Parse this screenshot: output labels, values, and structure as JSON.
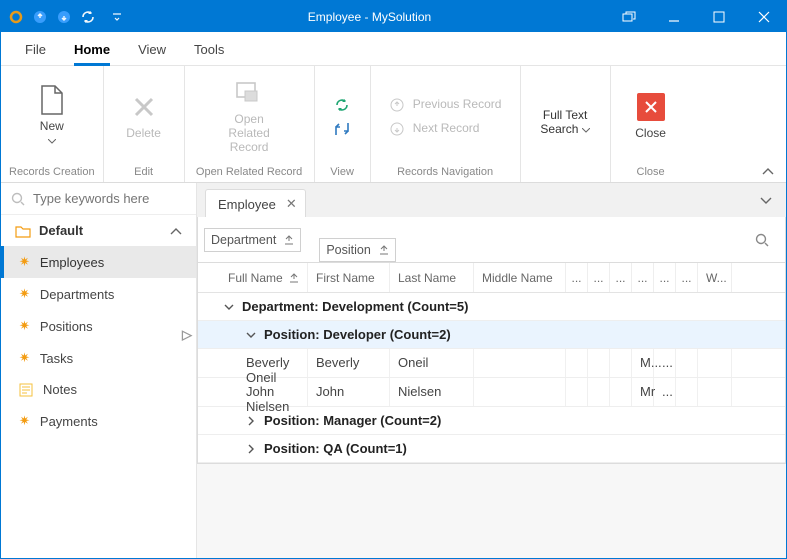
{
  "colors": {
    "accent": "#0078d4",
    "close_btn": "#e74c3c",
    "gear": "#f39c12"
  },
  "title": "Employee - MySolution",
  "menu": {
    "file": "File",
    "home": "Home",
    "view": "View",
    "tools": "Tools"
  },
  "ribbon": {
    "records_creation": {
      "new": "New",
      "label": "Records Creation"
    },
    "edit": {
      "delete": "Delete",
      "label": "Edit"
    },
    "open_related": {
      "open": "Open Related\nRecord",
      "label": "Open Related Record"
    },
    "view": {
      "label": "View"
    },
    "nav": {
      "prev": "Previous Record",
      "next": "Next Record",
      "label": "Records Navigation"
    },
    "search": {
      "fts": "Full Text\nSearch",
      "label": ""
    },
    "close": {
      "close": "Close",
      "label": "Close"
    }
  },
  "navpane": {
    "placeholder": "Type keywords here",
    "group": "Default",
    "items": [
      {
        "key": "employees",
        "label": "Employees",
        "icon": "gear"
      },
      {
        "key": "departments",
        "label": "Departments",
        "icon": "gear"
      },
      {
        "key": "positions",
        "label": "Positions",
        "icon": "gear"
      },
      {
        "key": "tasks",
        "label": "Tasks",
        "icon": "gear"
      },
      {
        "key": "notes",
        "label": "Notes",
        "icon": "notes"
      },
      {
        "key": "payments",
        "label": "Payments",
        "icon": "gear"
      }
    ]
  },
  "tab": {
    "label": "Employee"
  },
  "groupbar": {
    "department": "Department",
    "position": "Position"
  },
  "columns": {
    "full": "Full Name",
    "first": "First Name",
    "last": "Last Name",
    "middle": "Middle Name",
    "ellipsis": "...",
    "w": "W..."
  },
  "rows": {
    "g_department": "Department: Development (Count=5)",
    "g_position_dev": "Position: Developer (Count=2)",
    "r1_full": "Beverly Oneil",
    "r1_first": "Beverly",
    "r1_last": "Oneil",
    "r1_t": "M...",
    "r2_full": "John Nielsen",
    "r2_first": "John",
    "r2_last": "Nielsen",
    "r2_t": "Mr",
    "g_position_mgr": "Position: Manager (Count=2)",
    "g_position_qa": "Position: QA (Count=1)"
  }
}
